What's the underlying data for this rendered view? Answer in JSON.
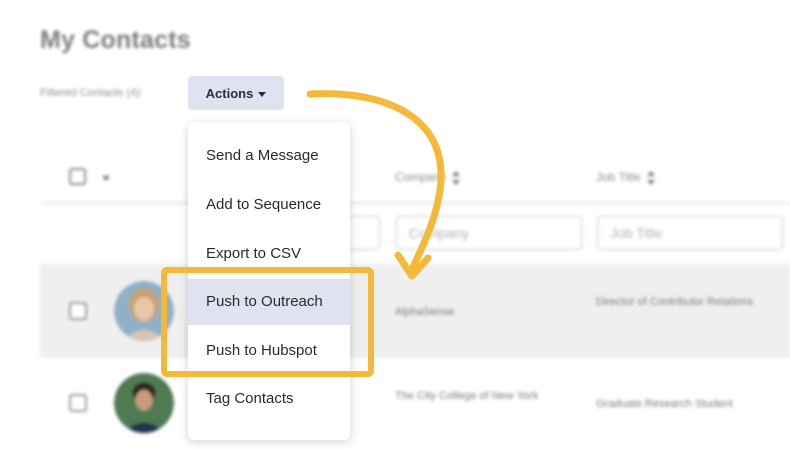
{
  "page": {
    "title": "My Contacts",
    "filtered_label": "Filtered Contacts (4):"
  },
  "actions": {
    "label": "Actions",
    "menu": [
      "Send a Message",
      "Add to Sequence",
      "Export to CSV",
      "Push to Outreach",
      "Push to Hubspot",
      "Tag Contacts"
    ],
    "active_item": "Push to Outreach"
  },
  "table": {
    "columns": [
      "Company",
      "Job Title"
    ],
    "filters": {
      "company_placeholder": "Company",
      "job_title_placeholder": "Job Title"
    },
    "rows": [
      {
        "company": "AlphaSense",
        "job_title": "Director of Contributor Relations"
      },
      {
        "company": "The City College of New York",
        "job_title": "Graduate Research Student"
      }
    ]
  },
  "colors": {
    "annotation": "#f5b93a",
    "button_bg": "#dfe3ef",
    "row_highlight": "#efefef"
  },
  "icons": [
    "checkbox-icon",
    "chevron-down-icon",
    "sort-icon",
    "avatar"
  ]
}
